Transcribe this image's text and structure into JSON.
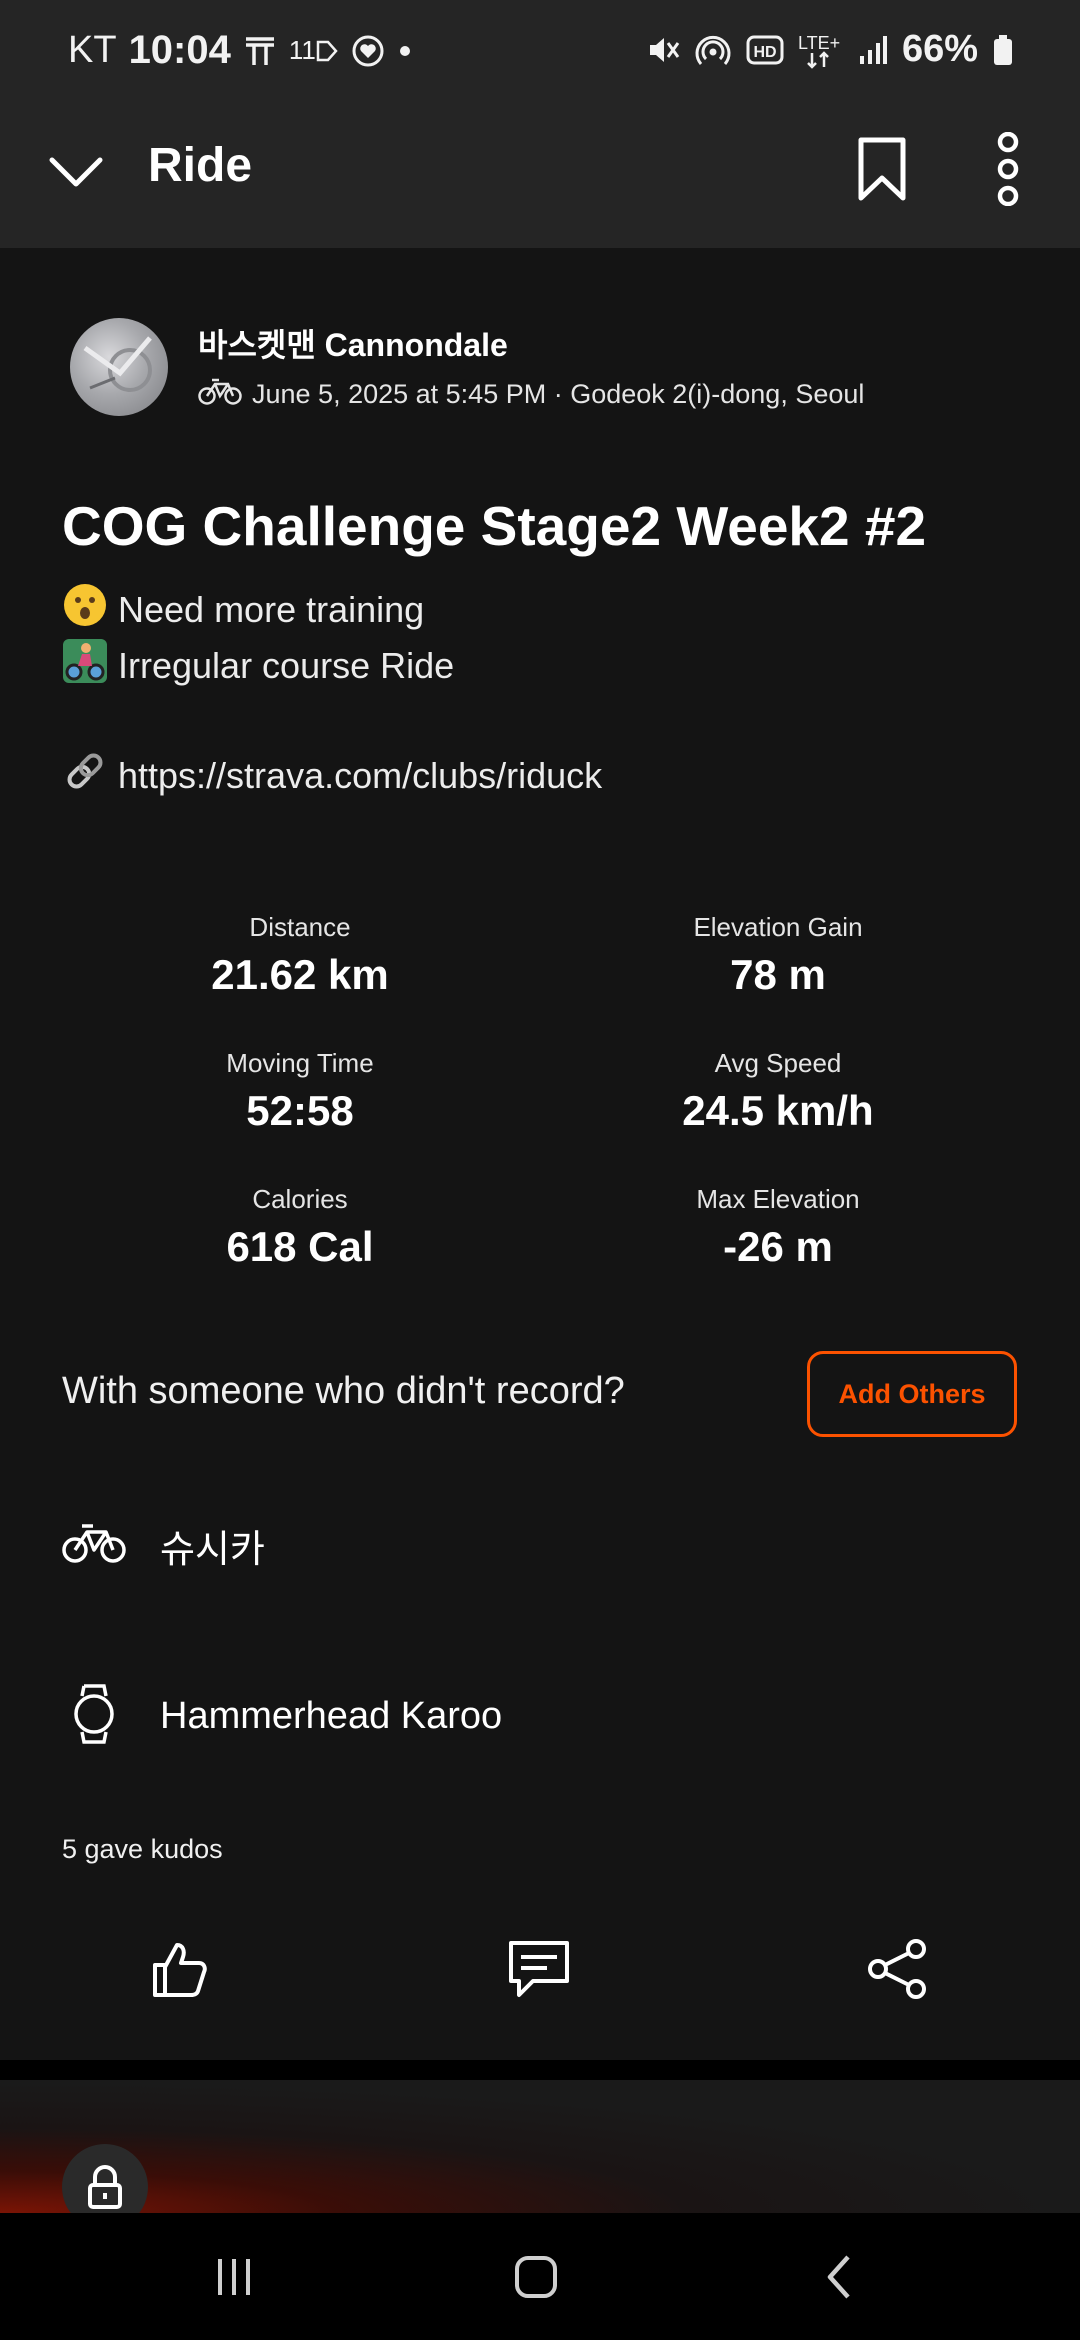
{
  "status_bar": {
    "carrier": "KT",
    "time": "10:04",
    "notif_11": "11",
    "battery": "66%"
  },
  "top_bar": {
    "title": "Ride"
  },
  "activity": {
    "athlete": "바스켓맨 Cannondale",
    "meta": "June 5, 2025 at 5:45 PM · Godeok 2(i)-dong, Seoul",
    "title": "COG Challenge Stage2 Week2 #2",
    "desc_line1": "Need more training",
    "desc_line2": "Irregular course Ride",
    "link": "https://strava.com/clubs/riduck"
  },
  "stats": [
    {
      "label": "Distance",
      "value": "21.62 km"
    },
    {
      "label": "Elevation Gain",
      "value": "78 m"
    },
    {
      "label": "Moving Time",
      "value": "52:58"
    },
    {
      "label": "Avg Speed",
      "value": "24.5 km/h"
    },
    {
      "label": "Calories",
      "value": "618 Cal"
    },
    {
      "label": "Max Elevation",
      "value": "-26 m"
    }
  ],
  "with_someone": "With someone who didn't record?",
  "add_others": "Add Others",
  "gear": {
    "bike": "슈시카",
    "device": "Hammerhead Karoo"
  },
  "kudos_text": "5 gave kudos",
  "colors": {
    "accent": "#fc5200",
    "background": "#141414",
    "bar": "#252525"
  },
  "icons": {
    "back": "chevron-down-icon",
    "bookmark": "bookmark-icon",
    "more": "more-vertical-icon",
    "kudos": "thumbs-up-icon",
    "comment": "comment-icon",
    "share": "share-icon",
    "lock": "lock-icon"
  }
}
